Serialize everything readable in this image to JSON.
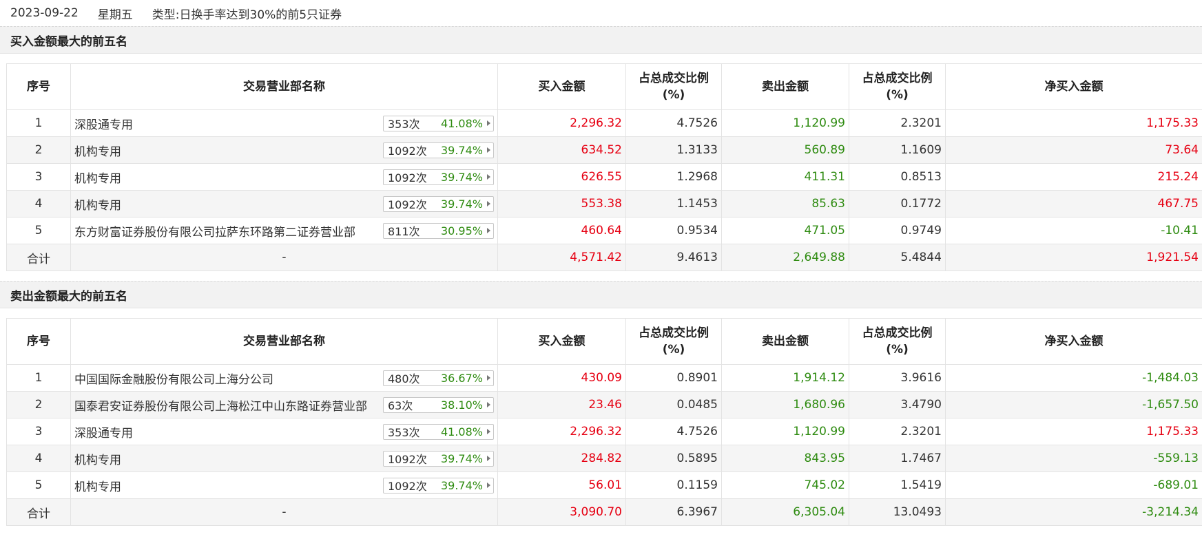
{
  "header": {
    "date": "2023-09-22",
    "weekday": "星期五",
    "type_label": "类型:日换手率达到30%的前5只证券"
  },
  "columns": {
    "idx": "序号",
    "name": "交易营业部名称",
    "buy": "买入金额",
    "buy_ratio": "占总成交比例\n(%)",
    "sell": "卖出金额",
    "sell_ratio": "占总成交比例\n(%)",
    "net": "净买入金额"
  },
  "buy_top": {
    "title": "买入金额最大的前五名",
    "rows": [
      {
        "idx": "1",
        "name": "深股通专用",
        "count": "353次",
        "pct": "41.08%",
        "buy": "2,296.32",
        "buy_ratio": "4.7526",
        "sell": "1,120.99",
        "sell_ratio": "2.3201",
        "net": "1,175.33"
      },
      {
        "idx": "2",
        "name": "机构专用",
        "count": "1092次",
        "pct": "39.74%",
        "buy": "634.52",
        "buy_ratio": "1.3133",
        "sell": "560.89",
        "sell_ratio": "1.1609",
        "net": "73.64"
      },
      {
        "idx": "3",
        "name": "机构专用",
        "count": "1092次",
        "pct": "39.74%",
        "buy": "626.55",
        "buy_ratio": "1.2968",
        "sell": "411.31",
        "sell_ratio": "0.8513",
        "net": "215.24"
      },
      {
        "idx": "4",
        "name": "机构专用",
        "count": "1092次",
        "pct": "39.74%",
        "buy": "553.38",
        "buy_ratio": "1.1453",
        "sell": "85.63",
        "sell_ratio": "0.1772",
        "net": "467.75"
      },
      {
        "idx": "5",
        "name": "东方财富证券股份有限公司拉萨东环路第二证券营业部",
        "count": "811次",
        "pct": "30.95%",
        "buy": "460.64",
        "buy_ratio": "0.9534",
        "sell": "471.05",
        "sell_ratio": "0.9749",
        "net": "-10.41"
      }
    ],
    "total": {
      "label": "合计",
      "name": "-",
      "buy": "4,571.42",
      "buy_ratio": "9.4613",
      "sell": "2,649.88",
      "sell_ratio": "5.4844",
      "net": "1,921.54"
    }
  },
  "sell_top": {
    "title": "卖出金额最大的前五名",
    "rows": [
      {
        "idx": "1",
        "name": "中国国际金融股份有限公司上海分公司",
        "count": "480次",
        "pct": "36.67%",
        "buy": "430.09",
        "buy_ratio": "0.8901",
        "sell": "1,914.12",
        "sell_ratio": "3.9616",
        "net": "-1,484.03"
      },
      {
        "idx": "2",
        "name": "国泰君安证券股份有限公司上海松江中山东路证券营业部",
        "count": "63次",
        "pct": "38.10%",
        "buy": "23.46",
        "buy_ratio": "0.0485",
        "sell": "1,680.96",
        "sell_ratio": "3.4790",
        "net": "-1,657.50"
      },
      {
        "idx": "3",
        "name": "深股通专用",
        "count": "353次",
        "pct": "41.08%",
        "buy": "2,296.32",
        "buy_ratio": "4.7526",
        "sell": "1,120.99",
        "sell_ratio": "2.3201",
        "net": "1,175.33"
      },
      {
        "idx": "4",
        "name": "机构专用",
        "count": "1092次",
        "pct": "39.74%",
        "buy": "284.82",
        "buy_ratio": "0.5895",
        "sell": "843.95",
        "sell_ratio": "1.7467",
        "net": "-559.13"
      },
      {
        "idx": "5",
        "name": "机构专用",
        "count": "1092次",
        "pct": "39.74%",
        "buy": "56.01",
        "buy_ratio": "0.1159",
        "sell": "745.02",
        "sell_ratio": "1.5419",
        "net": "-689.01"
      }
    ],
    "total": {
      "label": "合计",
      "name": "-",
      "buy": "3,090.70",
      "buy_ratio": "6.3967",
      "sell": "6,305.04",
      "sell_ratio": "13.0493",
      "net": "-3,214.34"
    }
  },
  "colors": {
    "up": "#e60012",
    "down": "#2e8b10"
  }
}
